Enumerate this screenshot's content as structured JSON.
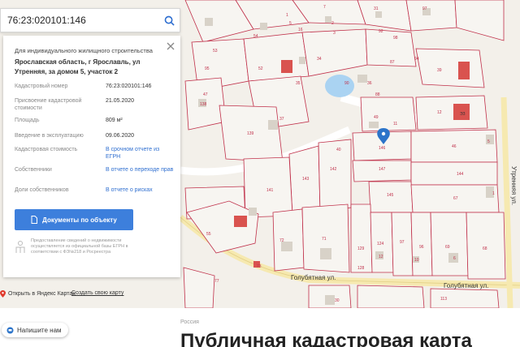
{
  "search": {
    "value": "76:23:020101:146"
  },
  "card": {
    "purpose": "Для индивидуального жилищного строительства",
    "address": "Ярославская область, г Ярославль, ул Утренняя, за домом 5, участок 2",
    "rows": [
      {
        "key": "Кадастровый номер",
        "value": "76:23:020101:146"
      },
      {
        "key": "Присвоение кадастровой стоимости",
        "value": "21.05.2020"
      },
      {
        "key": "Площадь",
        "value": "809 м²"
      },
      {
        "key": "Введение в эксплуатацию",
        "value": "09.06.2020"
      },
      {
        "key": "Кадастровая стоимость",
        "value": "В срочном отчете из ЕГРН"
      },
      {
        "key": "Собственники",
        "value": "В отчете о переходе прав"
      },
      {
        "key": "Доли собственников",
        "value": "В отчете о рисках"
      }
    ],
    "doc_button": "Документы по объекту",
    "note": "Предоставление сведений о недвижимости осуществляется из официальной базы ЕГРН в соответствии с ФЗ№218 и Росреестра"
  },
  "map": {
    "streets": [
      "Голубятная ул.",
      "Голубятная ул.",
      "Утренняя ул."
    ],
    "parcels": [
      "54",
      "5",
      "53",
      "16",
      "1",
      "2",
      "3",
      "7",
      "31",
      "92",
      "97",
      "98",
      "94",
      "34",
      "87",
      "95",
      "52",
      "35",
      "36",
      "90",
      "88",
      "39",
      "138",
      "47",
      "49",
      "11",
      "12",
      "139",
      "37",
      "40",
      "146",
      "46",
      "5",
      "147",
      "144",
      "143",
      "142",
      "141",
      "145",
      "67",
      "1",
      "72",
      "71",
      "124",
      "97",
      "96",
      "69",
      "68",
      "129",
      "12",
      "128",
      "10",
      "6",
      "55",
      "73",
      "77",
      "30",
      "113"
    ],
    "buildings": [
      "ЭЗ"
    ]
  },
  "links": {
    "open_yandex": "Открыть в Яндекс Картах",
    "make_map": "Создать свою карту"
  },
  "chat": {
    "label": "Напишите нам"
  },
  "footer": {
    "crumb": "Россия",
    "title": "Публичная кадастровая карта"
  },
  "colors": {
    "accent": "#3d7fdc",
    "parcel_line": "#c0304a",
    "map_bg": "#f2efe9"
  },
  "icons": [
    "search-icon",
    "close-icon",
    "document-icon",
    "map-pin-icon",
    "yandex-pin-icon",
    "chat-icon",
    "registry-icon"
  ]
}
